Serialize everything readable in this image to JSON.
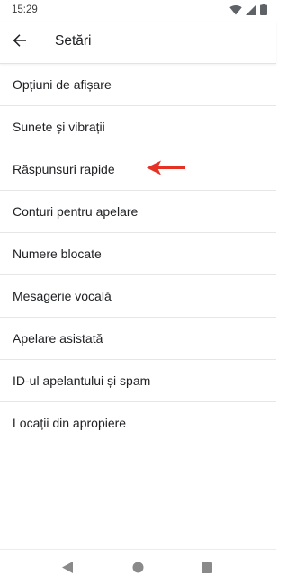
{
  "status_bar": {
    "time": "15:29",
    "icons": [
      "wifi-icon",
      "signal-icon",
      "battery-icon"
    ]
  },
  "app_bar": {
    "back_icon": "arrow-left-icon",
    "title": "Setări"
  },
  "settings": {
    "items": [
      {
        "label": "Opțiuni de afișare"
      },
      {
        "label": "Sunete și vibrații"
      },
      {
        "label": "Răspunsuri rapide"
      },
      {
        "label": "Conturi pentru apelare"
      },
      {
        "label": "Numere blocate"
      },
      {
        "label": "Mesagerie vocală"
      },
      {
        "label": "Apelare asistată"
      },
      {
        "label": "ID-ul apelantului și spam"
      },
      {
        "label": "Locații din apropiere"
      }
    ]
  },
  "annotation": {
    "arrow_color": "#e53224",
    "points_to": "Răspunsuri rapide"
  },
  "nav_bar": {
    "icons": [
      "back-triangle-icon",
      "home-circle-icon",
      "recents-square-icon"
    ]
  },
  "colors": {
    "divider": "#e6e6e6",
    "text": "#202124",
    "nav_icon": "#8a8a8a"
  }
}
